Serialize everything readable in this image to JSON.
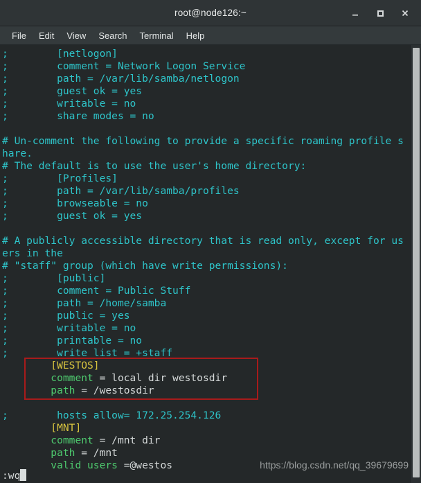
{
  "window": {
    "title": "root@node126:~",
    "controls": [
      {
        "name": "minimize",
        "label": "–"
      },
      {
        "name": "maximize",
        "label": "□"
      },
      {
        "name": "close",
        "label": "✕"
      }
    ]
  },
  "menubar": {
    "items": [
      "File",
      "Edit",
      "View",
      "Search",
      "Terminal",
      "Help"
    ]
  },
  "terminal": {
    "background": "#242829",
    "colors": {
      "comment": "#2ec4c9",
      "key": "#4ec96e",
      "section": "#d6c33f",
      "value": "#d4d8d8"
    },
    "lines": [
      [
        {
          "t": ";",
          "c": "cyan"
        },
        {
          "t": "        [netlogon]",
          "c": "cyan"
        }
      ],
      [
        {
          "t": ";",
          "c": "cyan"
        },
        {
          "t": "        comment = Network Logon Service",
          "c": "cyan"
        }
      ],
      [
        {
          "t": ";",
          "c": "cyan"
        },
        {
          "t": "        path = /var/lib/samba/netlogon",
          "c": "cyan"
        }
      ],
      [
        {
          "t": ";",
          "c": "cyan"
        },
        {
          "t": "        guest ok = yes",
          "c": "cyan"
        }
      ],
      [
        {
          "t": ";",
          "c": "cyan"
        },
        {
          "t": "        writable = no",
          "c": "cyan"
        }
      ],
      [
        {
          "t": ";",
          "c": "cyan"
        },
        {
          "t": "        share modes = no",
          "c": "cyan"
        }
      ],
      [
        {
          "t": "",
          "c": "cyan"
        }
      ],
      [
        {
          "t": "# Un-comment the following to provide a specific roaming profile s",
          "c": "cyan"
        }
      ],
      [
        {
          "t": "hare.",
          "c": "cyan"
        }
      ],
      [
        {
          "t": "# The default is to use the user's home directory:",
          "c": "cyan"
        }
      ],
      [
        {
          "t": ";",
          "c": "cyan"
        },
        {
          "t": "        [Profiles]",
          "c": "cyan"
        }
      ],
      [
        {
          "t": ";",
          "c": "cyan"
        },
        {
          "t": "        path = /var/lib/samba/profiles",
          "c": "cyan"
        }
      ],
      [
        {
          "t": ";",
          "c": "cyan"
        },
        {
          "t": "        browseable = no",
          "c": "cyan"
        }
      ],
      [
        {
          "t": ";",
          "c": "cyan"
        },
        {
          "t": "        guest ok = yes",
          "c": "cyan"
        }
      ],
      [
        {
          "t": "",
          "c": "cyan"
        }
      ],
      [
        {
          "t": "# A publicly accessible directory that is read only, except for us",
          "c": "cyan"
        }
      ],
      [
        {
          "t": "ers in the",
          "c": "cyan"
        }
      ],
      [
        {
          "t": "# \"staff\" group (which have write permissions):",
          "c": "cyan"
        }
      ],
      [
        {
          "t": ";",
          "c": "cyan"
        },
        {
          "t": "        [public]",
          "c": "cyan"
        }
      ],
      [
        {
          "t": ";",
          "c": "cyan"
        },
        {
          "t": "        comment = Public Stuff",
          "c": "cyan"
        }
      ],
      [
        {
          "t": ";",
          "c": "cyan"
        },
        {
          "t": "        path = /home/samba",
          "c": "cyan"
        }
      ],
      [
        {
          "t": ";",
          "c": "cyan"
        },
        {
          "t": "        public = yes",
          "c": "cyan"
        }
      ],
      [
        {
          "t": ";",
          "c": "cyan"
        },
        {
          "t": "        writable = no",
          "c": "cyan"
        }
      ],
      [
        {
          "t": ";",
          "c": "cyan"
        },
        {
          "t": "        printable = no",
          "c": "cyan"
        }
      ],
      [
        {
          "t": ";",
          "c": "cyan"
        },
        {
          "t": "        write list = +staff",
          "c": "cyan"
        }
      ],
      [
        {
          "t": "        ",
          "c": "white"
        },
        {
          "t": "[WESTOS]",
          "c": "yellow"
        }
      ],
      [
        {
          "t": "        ",
          "c": "white"
        },
        {
          "t": "comment",
          "c": "green"
        },
        {
          "t": " = local dir westosdir",
          "c": "white"
        }
      ],
      [
        {
          "t": "        ",
          "c": "white"
        },
        {
          "t": "path",
          "c": "green"
        },
        {
          "t": " = /westosdir",
          "c": "white"
        }
      ],
      [
        {
          "t": "",
          "c": "white"
        }
      ],
      [
        {
          "t": ";",
          "c": "cyan"
        },
        {
          "t": "        hosts allow= 172.25.254.126",
          "c": "cyan"
        }
      ],
      [
        {
          "t": "        ",
          "c": "white"
        },
        {
          "t": "[MNT]",
          "c": "yellow"
        }
      ],
      [
        {
          "t": "        ",
          "c": "white"
        },
        {
          "t": "comment",
          "c": "green"
        },
        {
          "t": " = /mnt dir",
          "c": "white"
        }
      ],
      [
        {
          "t": "        ",
          "c": "white"
        },
        {
          "t": "path",
          "c": "green"
        },
        {
          "t": " = /mnt",
          "c": "white"
        }
      ],
      [
        {
          "t": "        ",
          "c": "white"
        },
        {
          "t": "valid users",
          "c": "green"
        },
        {
          "t": " =@westos",
          "c": "white"
        }
      ]
    ]
  },
  "status": {
    "command": ":wq"
  },
  "annotation": {
    "highlight_color": "#a81b1b",
    "highlight_target": "[WESTOS] section"
  },
  "watermark": {
    "text": "https://blog.csdn.net/qq_39679699"
  }
}
